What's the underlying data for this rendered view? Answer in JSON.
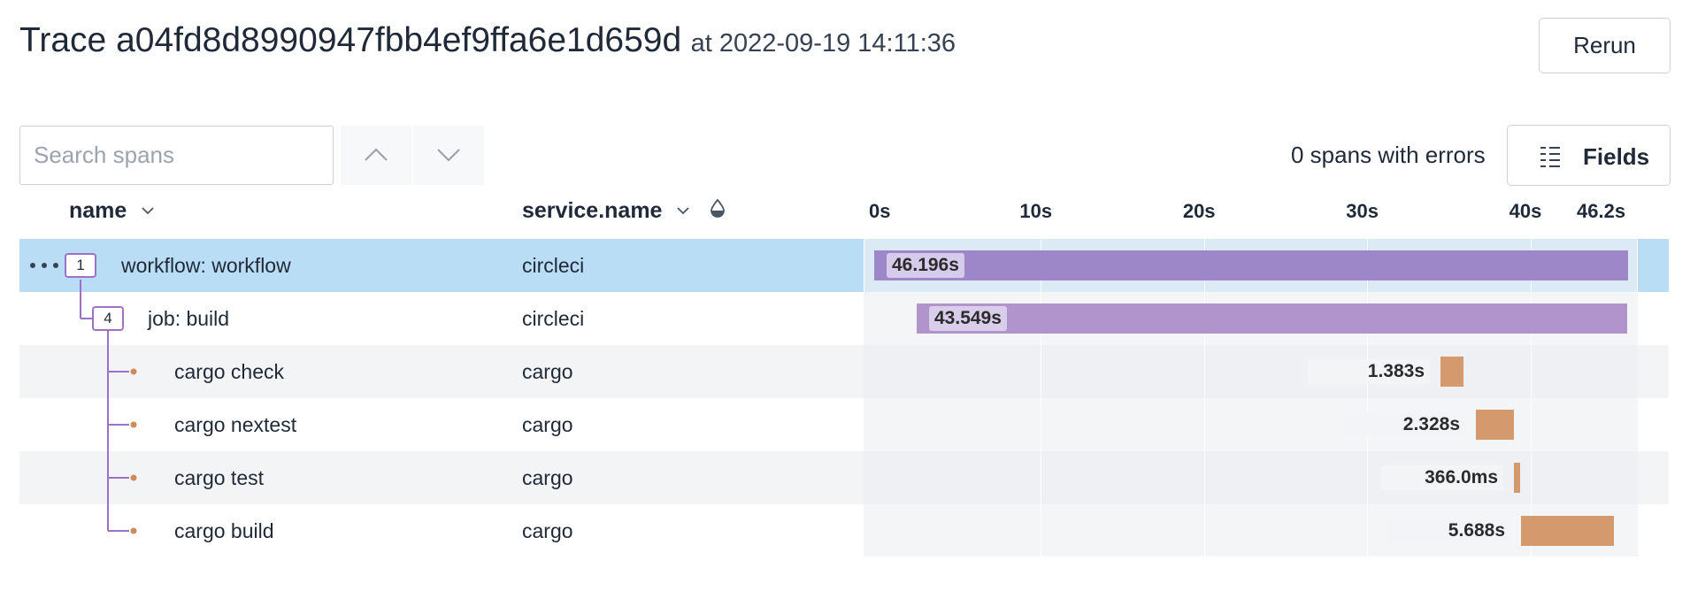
{
  "header": {
    "title": "Trace a04fd8d8990947fbb4ef9ffa6e1d659d",
    "timestamp": "at 2022-09-19 14:11:36",
    "rerun_label": "Rerun"
  },
  "toolbar": {
    "search_placeholder": "Search spans",
    "search_value": "",
    "prev_icon": "chevron-up-icon",
    "next_icon": "chevron-down-icon",
    "errors_summary": "0 spans with errors",
    "fields_label": "Fields",
    "fields_icon": "list-columns-icon"
  },
  "columns": {
    "name": "name",
    "service": "service.name",
    "service_icon": "color-drop-icon"
  },
  "timeline": {
    "ticks": [
      "0s",
      "10s",
      "20s",
      "30s",
      "40s",
      "46.2s"
    ],
    "total_seconds": 46.2
  },
  "spans": [
    {
      "name": "workflow: workflow",
      "service": "circleci",
      "duration_label": "46.196s",
      "start_s": 0.0,
      "duration_s": 46.196,
      "child_count": "1",
      "selected": true,
      "color": "#9d87c9"
    },
    {
      "name": "job: build",
      "service": "circleci",
      "duration_label": "43.549s",
      "start_s": 2.6,
      "duration_s": 43.549,
      "child_count": "4",
      "selected": false,
      "color": "#b094cb"
    },
    {
      "name": "cargo check",
      "service": "cargo",
      "duration_label": "1.383s",
      "start_s": 34.7,
      "duration_s": 1.383,
      "selected": false,
      "color": "#d49a6e"
    },
    {
      "name": "cargo nextest",
      "service": "cargo",
      "duration_label": "2.328s",
      "start_s": 36.85,
      "duration_s": 2.328,
      "selected": false,
      "color": "#d49a6e"
    },
    {
      "name": "cargo test",
      "service": "cargo",
      "duration_label": "366.0ms",
      "start_s": 39.2,
      "duration_s": 0.366,
      "selected": false,
      "color": "#d49a6e"
    },
    {
      "name": "cargo build",
      "service": "cargo",
      "duration_label": "5.688s",
      "start_s": 39.65,
      "duration_s": 5.688,
      "selected": false,
      "color": "#d49a6e"
    }
  ],
  "colors": {
    "selected_row": "#b8ddf5",
    "tree_line": "#9b72c6",
    "leaf_dot": "#d08a55"
  }
}
